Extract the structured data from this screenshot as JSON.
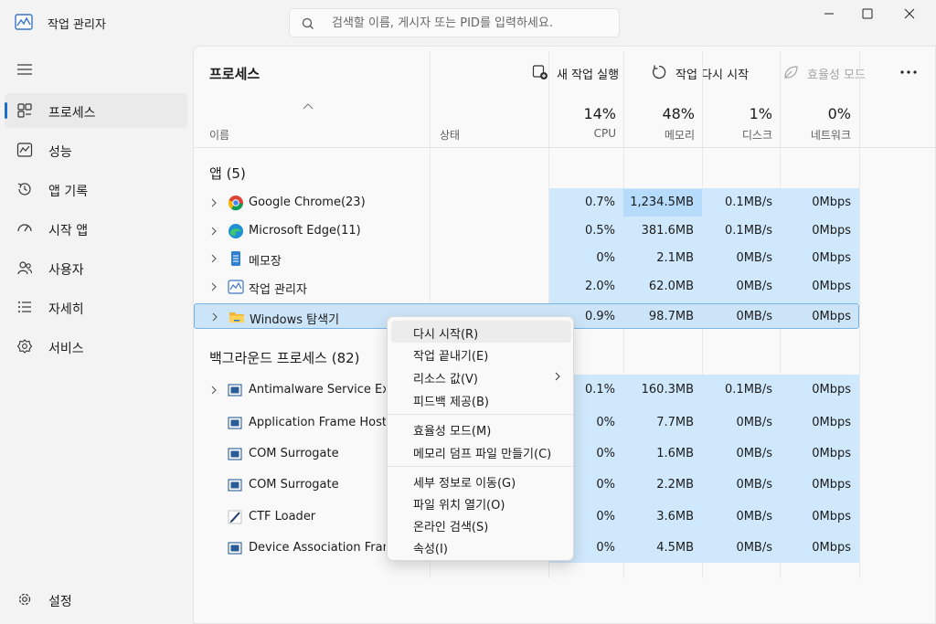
{
  "window": {
    "title": "작업 관리자",
    "search_placeholder": "검색할 이름, 게시자 또는 PID를 입력하세요."
  },
  "sidebar": {
    "items": [
      {
        "label": "프로세스",
        "icon": "processes-icon",
        "active": true
      },
      {
        "label": "성능",
        "icon": "performance-icon"
      },
      {
        "label": "앱 기록",
        "icon": "app-history-icon"
      },
      {
        "label": "시작 앱",
        "icon": "startup-apps-icon"
      },
      {
        "label": "사용자",
        "icon": "users-icon"
      },
      {
        "label": "자세히",
        "icon": "details-icon"
      },
      {
        "label": "서비스",
        "icon": "services-icon"
      }
    ],
    "settings_label": "설정"
  },
  "toolbar": {
    "title": "프로세스",
    "run_new_task": "새 작업 실행",
    "restart_task": "작업 다시 시작",
    "efficiency_mode": "효율성 모드"
  },
  "columns": {
    "name": "이름",
    "status": "상태",
    "cpu_pct": "14%",
    "cpu": "CPU",
    "memory_pct": "48%",
    "memory": "메모리",
    "disk_pct": "1%",
    "disk": "디스크",
    "network_pct": "0%",
    "network": "네트워크"
  },
  "apps_section": "앱 (5)",
  "apps": [
    {
      "name": "Google Chrome(23)",
      "icon": "chrome-icon",
      "cpu": "0.7%",
      "memory": "1,234.5MB",
      "disk": "0.1MB/s",
      "network": "0Mbps"
    },
    {
      "name": "Microsoft Edge(11)",
      "icon": "edge-icon",
      "cpu": "0.5%",
      "memory": "381.6MB",
      "disk": "0.1MB/s",
      "network": "0Mbps"
    },
    {
      "name": "메모장",
      "icon": "notepad-icon",
      "cpu": "0%",
      "memory": "2.1MB",
      "disk": "0MB/s",
      "network": "0Mbps"
    },
    {
      "name": "작업 관리자",
      "icon": "task-manager-icon",
      "cpu": "2.0%",
      "memory": "62.0MB",
      "disk": "0MB/s",
      "network": "0Mbps"
    },
    {
      "name": "Windows 탐색기",
      "icon": "folder-icon",
      "cpu": "0.9%",
      "memory": "98.7MB",
      "disk": "0MB/s",
      "network": "0Mbps"
    }
  ],
  "background_section": "백그라운드 프로세스 (82)",
  "background": [
    {
      "name": "Antimalware Service Executable",
      "icon": "service-icon",
      "cpu": "0.1%",
      "memory": "160.3MB",
      "disk": "0.1MB/s",
      "network": "0Mbps"
    },
    {
      "name": "Application Frame Host",
      "icon": "service-icon",
      "cpu": "0%",
      "memory": "7.7MB",
      "disk": "0MB/s",
      "network": "0Mbps"
    },
    {
      "name": "COM Surrogate",
      "icon": "service-icon",
      "cpu": "0%",
      "memory": "1.6MB",
      "disk": "0MB/s",
      "network": "0Mbps"
    },
    {
      "name": "COM Surrogate",
      "icon": "service-icon",
      "cpu": "0%",
      "memory": "2.2MB",
      "disk": "0MB/s",
      "network": "0Mbps"
    },
    {
      "name": "CTF Loader",
      "icon": "pen-icon",
      "cpu": "0%",
      "memory": "3.6MB",
      "disk": "0MB/s",
      "network": "0Mbps"
    },
    {
      "name": "Device Association Framework",
      "icon": "service-icon",
      "cpu": "0%",
      "memory": "4.5MB",
      "disk": "0MB/s",
      "network": "0Mbps"
    }
  ],
  "context_menu": [
    "다시 시작(R)",
    "작업 끝내기(E)",
    "리소스 값(V)",
    "피드백 제공(B)",
    "효율성 모드(M)",
    "메모리 덤프 파일 만들기(C)",
    "세부 정보로 이동(G)",
    "파일 위치 열기(O)",
    "온라인 검색(S)",
    "속성(I)"
  ],
  "colors": {
    "accent": "#1a6fc9",
    "heat": "#cfe8fc",
    "selected": "#cce4f7"
  }
}
